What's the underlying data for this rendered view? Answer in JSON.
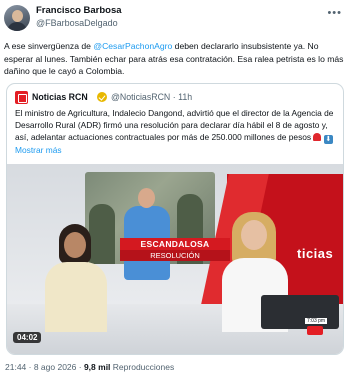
{
  "author": {
    "name": "Francisco Barbosa",
    "handle": "@FBarbosaDelgado"
  },
  "post": {
    "text_before": "A ese sinvergüenza de ",
    "mention": "@CesarPachonAgro",
    "text_after": " deben declararlo insubsistente ya. No esperar al lunes. También echar para atrás esa contratación. Esa ralea petrista es lo más dañino que le cayó a Colombia.",
    "time": "21:44",
    "date": "8 ago 2026",
    "views_count": "9,8 mil",
    "views_label": "Reproducciones"
  },
  "quote": {
    "name": "Noticias RCN",
    "handle": "@NoticiasRCN",
    "age": "11h",
    "text": "El ministro de Agricultura, Indalecio Dangond, advirtió que el director de la Agencia de Desarrollo Rural (ADR) firmó una resolución para declarar día hábil el 8 de agosto y, así, adelantar actuaciones contractuales por más de 250.000 millones de pesos ",
    "show_more": "Mostrar más",
    "video": {
      "lower_third_1": "ESCANDALOSA",
      "lower_third_2": "RESOLUCIÓN",
      "channel_text": "ticias",
      "clock": "7:03 pm",
      "duration": "04:02"
    }
  },
  "icons": {
    "more": "more-horizontal-icon",
    "verified": "verified-gold-icon",
    "siren": "police-light-emoji",
    "down_arrow": "down-arrow-emoji"
  },
  "colors": {
    "link": "#1d9bf0",
    "rcn_red": "#e31e24",
    "muted": "#536471"
  }
}
